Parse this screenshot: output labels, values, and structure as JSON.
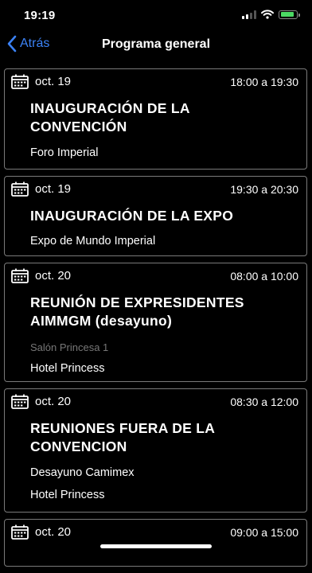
{
  "status": {
    "time": "19:19"
  },
  "nav": {
    "back_label": "Atrás",
    "title": "Programa general"
  },
  "events": [
    {
      "date": "oct. 19",
      "time": "18:00 a 19:30",
      "title": "INAUGURACIÓN DE LA CONVENCIÓN",
      "lines": [
        "Foro Imperial"
      ]
    },
    {
      "date": "oct. 19",
      "time": "19:30 a 20:30",
      "title": "INAUGURACIÓN DE LA EXPO",
      "lines": [
        "Expo de Mundo Imperial"
      ]
    },
    {
      "date": "oct. 20",
      "time": "08:00 a 10:00",
      "title": "REUNIÓN DE EXPRESIDENTES AIMMGM (desayuno)",
      "sublabel": "Salón Princesa 1",
      "lines": [
        "Hotel Princess"
      ]
    },
    {
      "date": "oct. 20",
      "time": "08:30 a 12:00",
      "title": "REUNIONES FUERA DE LA CONVENCION",
      "lines": [
        "Desayuno Camimex",
        "Hotel Princess"
      ]
    },
    {
      "date": "oct. 20",
      "time": "09:00 a 15:00"
    }
  ],
  "colors": {
    "accent": "#3b82f6",
    "border": "#7a7a7a",
    "battery": "#4cd964"
  }
}
